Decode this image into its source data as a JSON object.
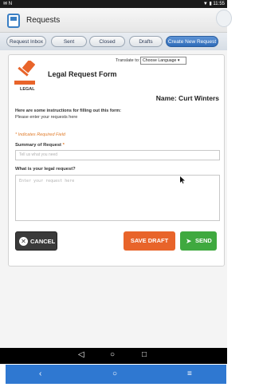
{
  "status_bar": {
    "left_icons": "✉ N",
    "right_text": "▼ ▮ 11:55"
  },
  "app": {
    "title": "Requests"
  },
  "tabs": [
    {
      "label": "Request Inbox"
    },
    {
      "label": "Sent"
    },
    {
      "label": "Closed"
    },
    {
      "label": "Drafts"
    },
    {
      "label": "Create New Request",
      "active": true
    }
  ],
  "form": {
    "translate_label": "Translate to:",
    "language_select": "Choose Language ▾",
    "logo_label": "LEGAL",
    "title": "Legal Request Form",
    "name_line": "Name: Curt Winters",
    "instructions_heading": "Here are some instructions for filling out this form:",
    "instructions_body": "Please enter your requests here",
    "required_note": "* Indicates Required Field",
    "summary_label": "Summary of Request",
    "summary_placeholder": "Tell us what you need",
    "legal_question_label": "What is your legal request?",
    "legal_placeholder": "Enter your request here"
  },
  "buttons": {
    "cancel": "CANCEL",
    "save_draft": "SAVE DRAFT",
    "send": "SEND"
  },
  "icons": {
    "cancel": "close-circle-icon",
    "send": "paper-plane-icon",
    "logo": "gavel-icon"
  },
  "colors": {
    "tab_active": "#2f6bb8",
    "save_draft": "#e8642a",
    "send": "#3fa93f",
    "cancel": "#3a3a3a",
    "required": "#e07b2a",
    "bottom_bar": "#2f78d1"
  },
  "android_nav": {
    "back": "◁",
    "home": "○",
    "recents": "□"
  },
  "bottom_nav": {
    "back": "‹",
    "home": "○",
    "menu": "≡"
  }
}
